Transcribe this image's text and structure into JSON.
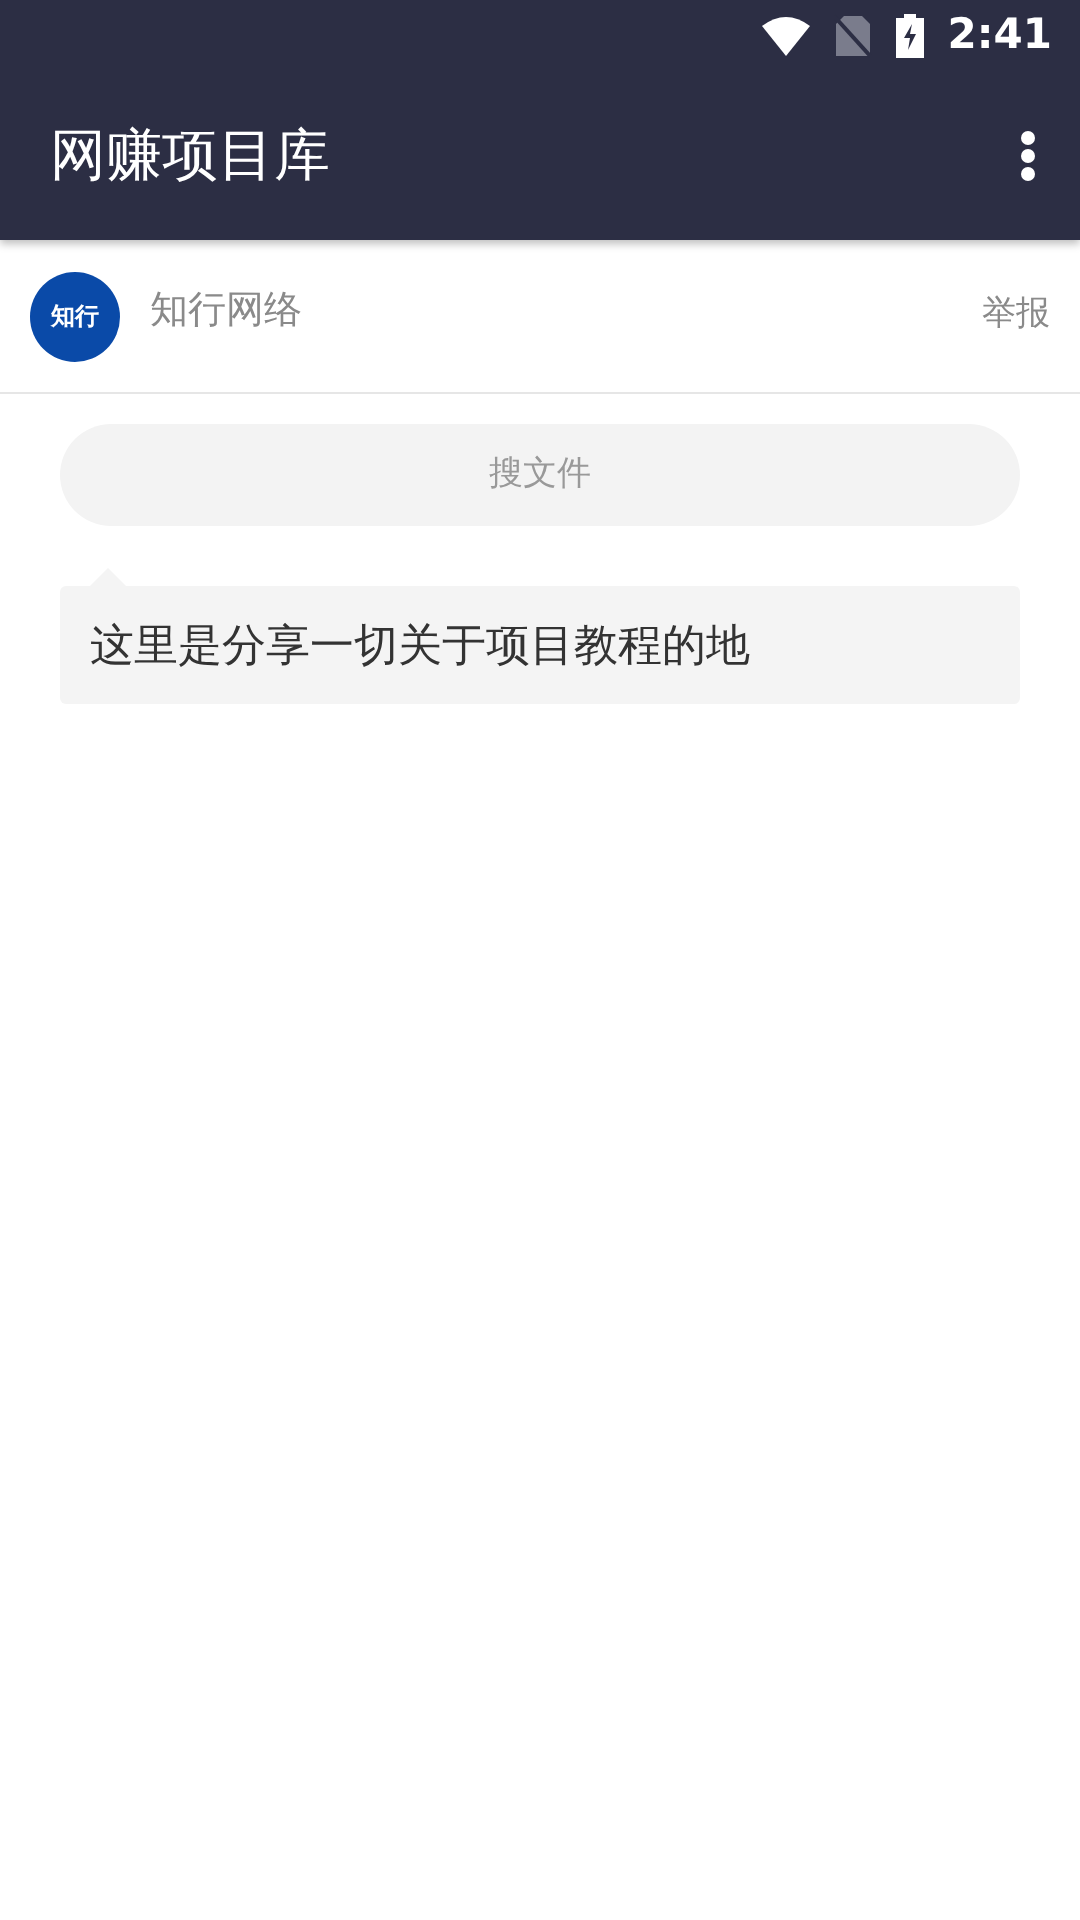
{
  "status_bar": {
    "time": "2:41"
  },
  "app_bar": {
    "title": "网赚项目库"
  },
  "owner": {
    "avatar_text": "知行",
    "name": "知行网络",
    "report": "举报"
  },
  "search": {
    "label": "搜文件"
  },
  "message": {
    "text": "这里是分享一切关于项目教程的地"
  }
}
